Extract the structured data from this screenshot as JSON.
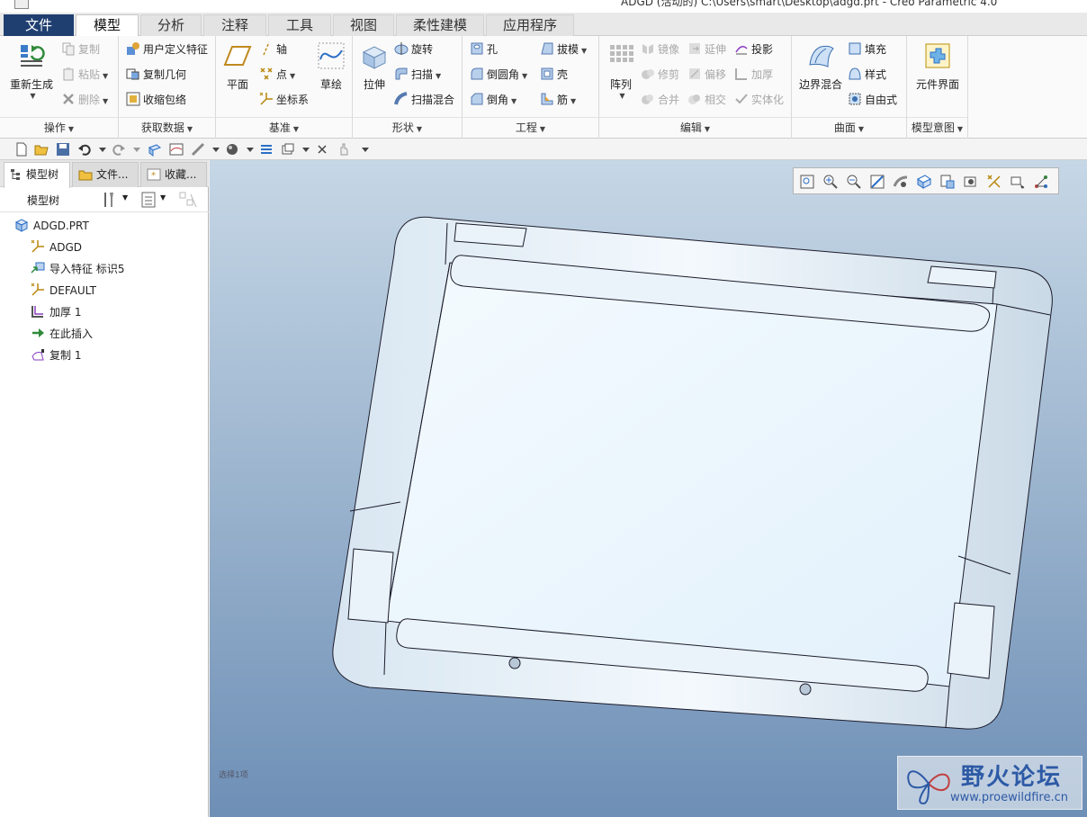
{
  "window": {
    "title": "ADGD (活动的) C:\\Users\\smart\\Desktop\\adgd.prt - Creo Parametric 4.0"
  },
  "tabs": [
    {
      "label": "文件"
    },
    {
      "label": "模型"
    },
    {
      "label": "分析"
    },
    {
      "label": "注释"
    },
    {
      "label": "工具"
    },
    {
      "label": "视图"
    },
    {
      "label": "柔性建模"
    },
    {
      "label": "应用程序"
    }
  ],
  "ribbon": {
    "ops": {
      "footer": "操作",
      "regen": "重新生成",
      "copy": "复制",
      "paste": "粘贴",
      "delete": "删除"
    },
    "getdata": {
      "footer": "获取数据",
      "udf": "用户定义特征",
      "copygeom": "复制几何",
      "shrinkwrap": "收缩包络"
    },
    "datum": {
      "footer": "基准",
      "plane": "平面",
      "axis": "轴",
      "point": "点",
      "csys": "坐标系",
      "sketch": "草绘"
    },
    "shapes": {
      "footer": "形状",
      "extrude": "拉伸",
      "revolve": "旋转",
      "sweep": "扫描",
      "sweptblend": "扫描混合"
    },
    "engineering": {
      "footer": "工程",
      "hole": "孔",
      "round": "倒圆角",
      "chamfer": "倒角",
      "draft": "拔模",
      "shell": "壳",
      "rib": "筋"
    },
    "editing": {
      "footer": "编辑",
      "pattern": "阵列",
      "mirror": "镜像",
      "extend": "延伸",
      "project": "投影",
      "trim": "修剪",
      "offset": "偏移",
      "thicken": "加厚",
      "merge": "合并",
      "intersect": "相交",
      "solidify": "实体化"
    },
    "surfaces": {
      "footer": "曲面",
      "boundary": "边界混合",
      "fill": "填充",
      "style": "样式",
      "freestyle": "自由式"
    },
    "intent": {
      "footer": "模型意图",
      "compinterface": "元件界面"
    }
  },
  "leftpanel": {
    "tabs": [
      "模型树",
      "文件...",
      "收藏..."
    ],
    "header_label": "模型树",
    "tree": [
      {
        "label": "ADGD.PRT",
        "icon": "part-icon"
      },
      {
        "label": "ADGD",
        "icon": "csys-icon"
      },
      {
        "label": "导入特征 标识5",
        "icon": "import-feature-icon"
      },
      {
        "label": "DEFAULT",
        "icon": "csys-icon"
      },
      {
        "label": "加厚 1",
        "icon": "thicken-icon"
      },
      {
        "label": "在此插入",
        "icon": "insert-here-arrow-icon"
      },
      {
        "label": "复制 1",
        "icon": "copy-surface-icon"
      }
    ]
  },
  "viewport": {
    "status_msg": "选择1项",
    "watermark": {
      "cn": "野火论坛",
      "url": "www.proewildfire.cn"
    }
  },
  "colors": {
    "file_tab": "#1f3f71",
    "accent_blue": "#2b6fc7",
    "view_bg_top": "#c6d7e6",
    "view_bg_bottom": "#6e8fb6"
  }
}
